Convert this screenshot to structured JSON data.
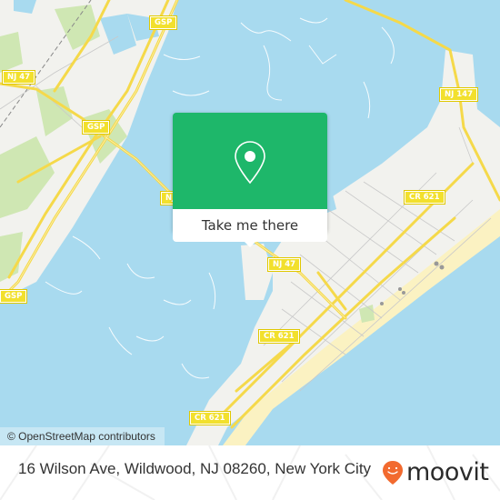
{
  "map": {
    "attribution": "© OpenStreetMap contributors",
    "road_labels": [
      {
        "id": "gsp-top",
        "text": "GSP"
      },
      {
        "id": "nj47-left",
        "text": "NJ 47"
      },
      {
        "id": "gsp-mid",
        "text": "GSP"
      },
      {
        "id": "nj47-popup-left",
        "text": "NJ 47"
      },
      {
        "id": "nj147",
        "text": "NJ 147"
      },
      {
        "id": "cr621-upper",
        "text": "CR 621"
      },
      {
        "id": "nj47-center",
        "text": "NJ 47"
      },
      {
        "id": "cr621-mid",
        "text": "CR 621"
      },
      {
        "id": "gsp-bottom-left",
        "text": "GSP"
      },
      {
        "id": "cr621-lower",
        "text": "CR 621"
      }
    ],
    "colors": {
      "water": "#a8daef",
      "land": "#f2f2ee",
      "park": "#cfe7b3",
      "beach": "#fbf2c2",
      "road": "#f7e37a"
    }
  },
  "popup": {
    "icon": "map-pin-icon",
    "action_label": "Take me there",
    "accent_color": "#1eb76a"
  },
  "footer": {
    "address": "16 Wilson Ave, Wildwood, NJ 08260, New York City",
    "brand": "moovit",
    "brand_color": "#f26a2f"
  }
}
